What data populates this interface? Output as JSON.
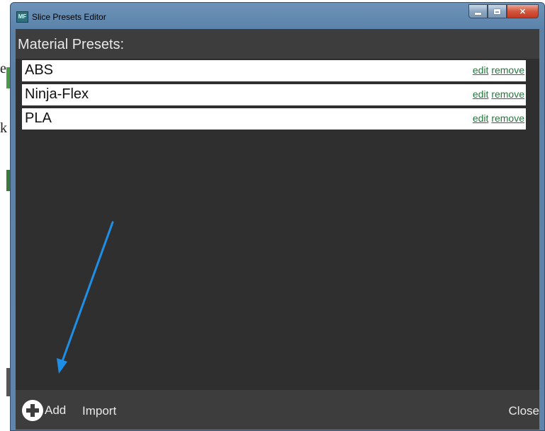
{
  "window": {
    "title": "Slice Presets Editor",
    "icon_text": "MF"
  },
  "header": {
    "title": "Material Presets:"
  },
  "presets": [
    {
      "name": "ABS",
      "edit_label": "edit",
      "remove_label": "remove"
    },
    {
      "name": "Ninja-Flex",
      "edit_label": "edit",
      "remove_label": "remove"
    },
    {
      "name": "PLA",
      "edit_label": "edit",
      "remove_label": "remove"
    }
  ],
  "footer": {
    "add_label": "Add",
    "import_label": "Import",
    "close_label": "Close"
  },
  "background": {
    "chars": [
      "e",
      "k"
    ]
  },
  "colors": {
    "annotation_arrow": "#1e8fe6",
    "link": "#1f7a3a",
    "panel": "#2f2f2f",
    "bar": "#3d3d3d"
  },
  "icons": [
    "app-icon",
    "minimize-icon",
    "maximize-icon",
    "close-icon",
    "add-icon",
    "annotation-arrow"
  ]
}
